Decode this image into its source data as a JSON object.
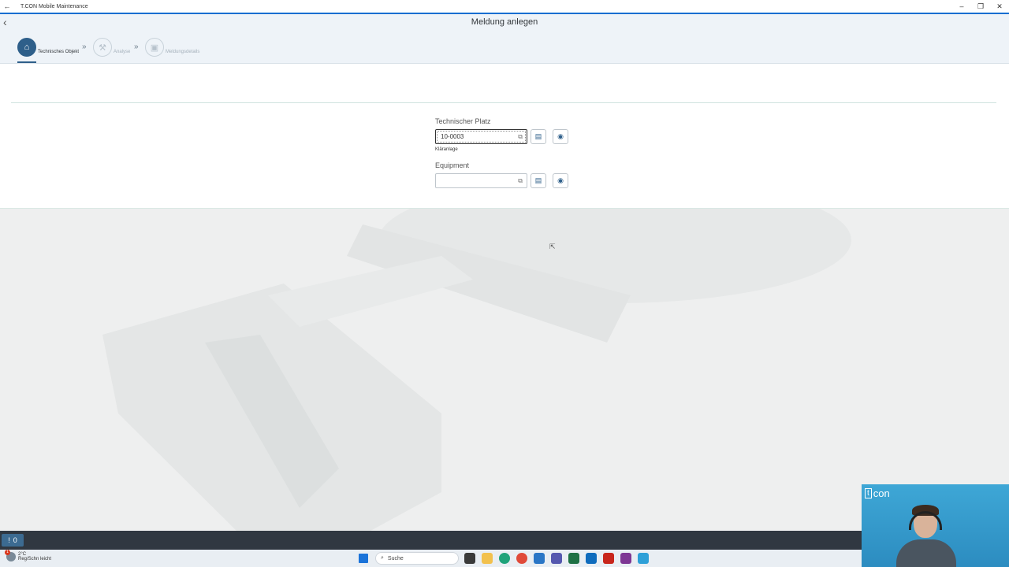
{
  "window": {
    "title": "T.CON Mobile Maintenance",
    "minimize": "–",
    "restore": "❐",
    "close": "✕"
  },
  "shell": {
    "back_glyph": "‹",
    "page_title": "Meldung anlegen"
  },
  "wizard": {
    "steps": [
      {
        "label": "Technisches Objekt",
        "icon": "building-icon",
        "glyph": "⌂",
        "active": true
      },
      {
        "label": "Analyse",
        "icon": "wrench-icon",
        "glyph": "⚒",
        "active": false
      },
      {
        "label": "Meldungsdetails",
        "icon": "document-icon",
        "glyph": "▣",
        "active": false
      }
    ],
    "chevron": "»"
  },
  "form": {
    "tech_place": {
      "label": "Technischer Platz",
      "value": "10-0003",
      "description": "Kläranlage",
      "value_help_glyph": "⧉",
      "btn1_glyph": "▤",
      "btn2_glyph": "◉"
    },
    "equipment": {
      "label": "Equipment",
      "value": "",
      "value_help_glyph": "⧉",
      "btn1_glyph": "▤",
      "btn2_glyph": "◉"
    }
  },
  "appbar": {
    "messages_count": "0",
    "messages_glyph": "!"
  },
  "taskbar": {
    "weather_temp": "2°C",
    "weather_desc": "Reg/Schn leicht",
    "weather_badge": "1",
    "search_placeholder": "Suche",
    "search_glyph": "⌕"
  },
  "webcam": {
    "logo_bracket": "t",
    "logo_text": "con"
  },
  "colors": {
    "accent": "#0a6ed1",
    "step_active": "#2e5f8a",
    "appbar": "#303841",
    "cam_bg": "#3ea7d6"
  }
}
